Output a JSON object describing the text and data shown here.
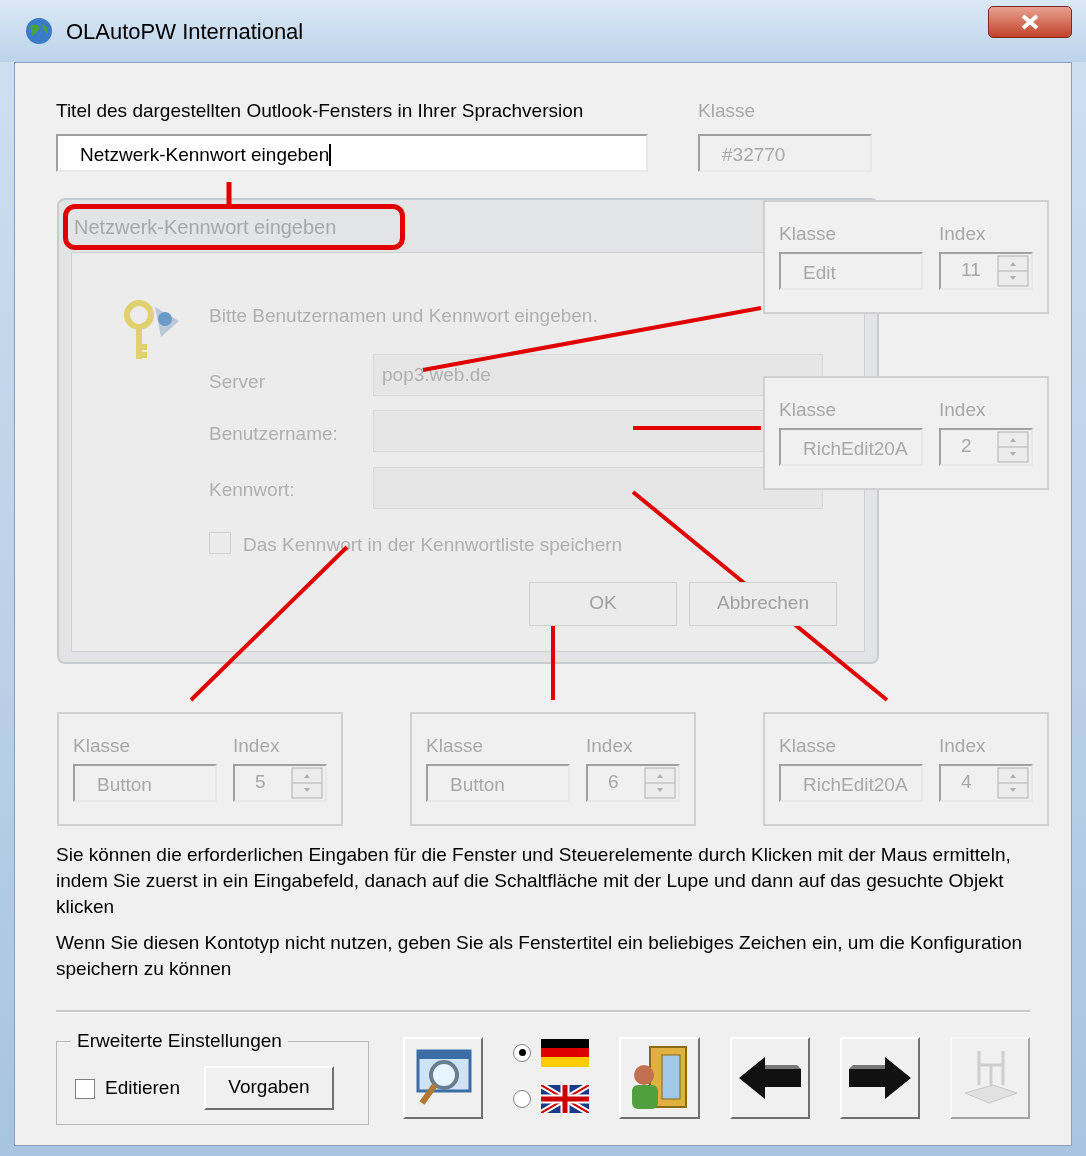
{
  "window": {
    "title": "OLAutoPW International"
  },
  "title_field": {
    "label": "Titel des dargestellten Outlook-Fensters in Ihrer Sprachversion",
    "value": "Netzwerk-Kennwort eingeben"
  },
  "class_field": {
    "label": "Klasse",
    "value": "#32770"
  },
  "preview_dialog": {
    "title": "Netzwerk-Kennwort eingeben",
    "message": "Bitte Benutzernamen und Kennwort eingeben.",
    "fields": [
      {
        "label": "Server",
        "value": "pop3.web.de"
      },
      {
        "label": "Benutzername:"
      },
      {
        "label": "Kennwort:"
      }
    ],
    "checkbox": {
      "label": "Das Kennwort in der Kennwortliste speichern",
      "checked": false
    },
    "buttons": [
      "OK",
      "Abbrechen"
    ]
  },
  "controls": [
    {
      "class_label": "Klasse",
      "class_value": "Edit",
      "index_label": "Index",
      "index_value": "11"
    },
    {
      "class_label": "Klasse",
      "class_value": "RichEdit20A",
      "index_label": "Index",
      "index_value": "2"
    },
    {
      "class_label": "Klasse",
      "class_value": "Button",
      "index_label": "Index",
      "index_value": "5"
    },
    {
      "class_label": "Klasse",
      "class_value": "Button",
      "index_label": "Index",
      "index_value": "6"
    },
    {
      "class_label": "Klasse",
      "class_value": "RichEdit20A",
      "index_label": "Index",
      "index_value": "4"
    }
  ],
  "help_text": [
    "Sie können die erforderlichen Eingaben für die Fenster und Steuerelemente durch Klicken mit der Maus ermitteln, indem Sie zuerst in ein Eingabefeld, danach auf die Schaltfläche mit der Lupe und dann auf das gesuchte Objekt klicken",
    "Wenn Sie diesen Kontotyp nicht nutzen, geben Sie als Fenstertitel ein beliebiges Zeichen ein, um die Konfiguration speichern zu können"
  ],
  "advanced": {
    "legend": "Erweiterte Einstellungen",
    "checkbox": {
      "label": "Editieren",
      "checked": false
    },
    "button": "Vorgaben"
  },
  "languages": [
    {
      "kind": "german",
      "selected": true
    },
    {
      "kind": "british",
      "selected": false
    }
  ],
  "toolbar": [
    {
      "kind": "find",
      "disabled": false
    },
    {
      "kind": "exit",
      "disabled": false
    },
    {
      "kind": "back",
      "disabled": false
    },
    {
      "kind": "forward",
      "disabled": false
    },
    {
      "kind": "install",
      "disabled": true
    }
  ]
}
